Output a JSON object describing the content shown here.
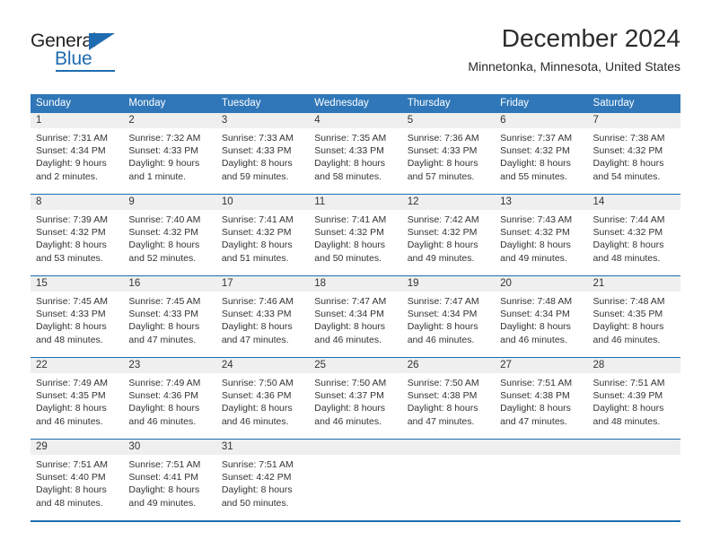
{
  "brand": {
    "name_part1": "General",
    "name_part2": "Blue",
    "accent_color": "#1f6cb0"
  },
  "header": {
    "title": "December 2024",
    "subtitle": "Minnetonka, Minnesota, United States"
  },
  "calendar": {
    "header_bg": "#2f77b8",
    "daynum_bg": "#efefef",
    "weekday_headers": [
      "Sunday",
      "Monday",
      "Tuesday",
      "Wednesday",
      "Thursday",
      "Friday",
      "Saturday"
    ],
    "weeks": [
      [
        {
          "day": "1",
          "sunrise": "Sunrise: 7:31 AM",
          "sunset": "Sunset: 4:34 PM",
          "daylight_line1": "Daylight: 9 hours",
          "daylight_line2": "and 2 minutes."
        },
        {
          "day": "2",
          "sunrise": "Sunrise: 7:32 AM",
          "sunset": "Sunset: 4:33 PM",
          "daylight_line1": "Daylight: 9 hours",
          "daylight_line2": "and 1 minute."
        },
        {
          "day": "3",
          "sunrise": "Sunrise: 7:33 AM",
          "sunset": "Sunset: 4:33 PM",
          "daylight_line1": "Daylight: 8 hours",
          "daylight_line2": "and 59 minutes."
        },
        {
          "day": "4",
          "sunrise": "Sunrise: 7:35 AM",
          "sunset": "Sunset: 4:33 PM",
          "daylight_line1": "Daylight: 8 hours",
          "daylight_line2": "and 58 minutes."
        },
        {
          "day": "5",
          "sunrise": "Sunrise: 7:36 AM",
          "sunset": "Sunset: 4:33 PM",
          "daylight_line1": "Daylight: 8 hours",
          "daylight_line2": "and 57 minutes."
        },
        {
          "day": "6",
          "sunrise": "Sunrise: 7:37 AM",
          "sunset": "Sunset: 4:32 PM",
          "daylight_line1": "Daylight: 8 hours",
          "daylight_line2": "and 55 minutes."
        },
        {
          "day": "7",
          "sunrise": "Sunrise: 7:38 AM",
          "sunset": "Sunset: 4:32 PM",
          "daylight_line1": "Daylight: 8 hours",
          "daylight_line2": "and 54 minutes."
        }
      ],
      [
        {
          "day": "8",
          "sunrise": "Sunrise: 7:39 AM",
          "sunset": "Sunset: 4:32 PM",
          "daylight_line1": "Daylight: 8 hours",
          "daylight_line2": "and 53 minutes."
        },
        {
          "day": "9",
          "sunrise": "Sunrise: 7:40 AM",
          "sunset": "Sunset: 4:32 PM",
          "daylight_line1": "Daylight: 8 hours",
          "daylight_line2": "and 52 minutes."
        },
        {
          "day": "10",
          "sunrise": "Sunrise: 7:41 AM",
          "sunset": "Sunset: 4:32 PM",
          "daylight_line1": "Daylight: 8 hours",
          "daylight_line2": "and 51 minutes."
        },
        {
          "day": "11",
          "sunrise": "Sunrise: 7:41 AM",
          "sunset": "Sunset: 4:32 PM",
          "daylight_line1": "Daylight: 8 hours",
          "daylight_line2": "and 50 minutes."
        },
        {
          "day": "12",
          "sunrise": "Sunrise: 7:42 AM",
          "sunset": "Sunset: 4:32 PM",
          "daylight_line1": "Daylight: 8 hours",
          "daylight_line2": "and 49 minutes."
        },
        {
          "day": "13",
          "sunrise": "Sunrise: 7:43 AM",
          "sunset": "Sunset: 4:32 PM",
          "daylight_line1": "Daylight: 8 hours",
          "daylight_line2": "and 49 minutes."
        },
        {
          "day": "14",
          "sunrise": "Sunrise: 7:44 AM",
          "sunset": "Sunset: 4:32 PM",
          "daylight_line1": "Daylight: 8 hours",
          "daylight_line2": "and 48 minutes."
        }
      ],
      [
        {
          "day": "15",
          "sunrise": "Sunrise: 7:45 AM",
          "sunset": "Sunset: 4:33 PM",
          "daylight_line1": "Daylight: 8 hours",
          "daylight_line2": "and 48 minutes."
        },
        {
          "day": "16",
          "sunrise": "Sunrise: 7:45 AM",
          "sunset": "Sunset: 4:33 PM",
          "daylight_line1": "Daylight: 8 hours",
          "daylight_line2": "and 47 minutes."
        },
        {
          "day": "17",
          "sunrise": "Sunrise: 7:46 AM",
          "sunset": "Sunset: 4:33 PM",
          "daylight_line1": "Daylight: 8 hours",
          "daylight_line2": "and 47 minutes."
        },
        {
          "day": "18",
          "sunrise": "Sunrise: 7:47 AM",
          "sunset": "Sunset: 4:34 PM",
          "daylight_line1": "Daylight: 8 hours",
          "daylight_line2": "and 46 minutes."
        },
        {
          "day": "19",
          "sunrise": "Sunrise: 7:47 AM",
          "sunset": "Sunset: 4:34 PM",
          "daylight_line1": "Daylight: 8 hours",
          "daylight_line2": "and 46 minutes."
        },
        {
          "day": "20",
          "sunrise": "Sunrise: 7:48 AM",
          "sunset": "Sunset: 4:34 PM",
          "daylight_line1": "Daylight: 8 hours",
          "daylight_line2": "and 46 minutes."
        },
        {
          "day": "21",
          "sunrise": "Sunrise: 7:48 AM",
          "sunset": "Sunset: 4:35 PM",
          "daylight_line1": "Daylight: 8 hours",
          "daylight_line2": "and 46 minutes."
        }
      ],
      [
        {
          "day": "22",
          "sunrise": "Sunrise: 7:49 AM",
          "sunset": "Sunset: 4:35 PM",
          "daylight_line1": "Daylight: 8 hours",
          "daylight_line2": "and 46 minutes."
        },
        {
          "day": "23",
          "sunrise": "Sunrise: 7:49 AM",
          "sunset": "Sunset: 4:36 PM",
          "daylight_line1": "Daylight: 8 hours",
          "daylight_line2": "and 46 minutes."
        },
        {
          "day": "24",
          "sunrise": "Sunrise: 7:50 AM",
          "sunset": "Sunset: 4:36 PM",
          "daylight_line1": "Daylight: 8 hours",
          "daylight_line2": "and 46 minutes."
        },
        {
          "day": "25",
          "sunrise": "Sunrise: 7:50 AM",
          "sunset": "Sunset: 4:37 PM",
          "daylight_line1": "Daylight: 8 hours",
          "daylight_line2": "and 46 minutes."
        },
        {
          "day": "26",
          "sunrise": "Sunrise: 7:50 AM",
          "sunset": "Sunset: 4:38 PM",
          "daylight_line1": "Daylight: 8 hours",
          "daylight_line2": "and 47 minutes."
        },
        {
          "day": "27",
          "sunrise": "Sunrise: 7:51 AM",
          "sunset": "Sunset: 4:38 PM",
          "daylight_line1": "Daylight: 8 hours",
          "daylight_line2": "and 47 minutes."
        },
        {
          "day": "28",
          "sunrise": "Sunrise: 7:51 AM",
          "sunset": "Sunset: 4:39 PM",
          "daylight_line1": "Daylight: 8 hours",
          "daylight_line2": "and 48 minutes."
        }
      ],
      [
        {
          "day": "29",
          "sunrise": "Sunrise: 7:51 AM",
          "sunset": "Sunset: 4:40 PM",
          "daylight_line1": "Daylight: 8 hours",
          "daylight_line2": "and 48 minutes."
        },
        {
          "day": "30",
          "sunrise": "Sunrise: 7:51 AM",
          "sunset": "Sunset: 4:41 PM",
          "daylight_line1": "Daylight: 8 hours",
          "daylight_line2": "and 49 minutes."
        },
        {
          "day": "31",
          "sunrise": "Sunrise: 7:51 AM",
          "sunset": "Sunset: 4:42 PM",
          "daylight_line1": "Daylight: 8 hours",
          "daylight_line2": "and 50 minutes."
        },
        {
          "day": "",
          "sunrise": "",
          "sunset": "",
          "daylight_line1": "",
          "daylight_line2": ""
        },
        {
          "day": "",
          "sunrise": "",
          "sunset": "",
          "daylight_line1": "",
          "daylight_line2": ""
        },
        {
          "day": "",
          "sunrise": "",
          "sunset": "",
          "daylight_line1": "",
          "daylight_line2": ""
        },
        {
          "day": "",
          "sunrise": "",
          "sunset": "",
          "daylight_line1": "",
          "daylight_line2": ""
        }
      ]
    ]
  }
}
